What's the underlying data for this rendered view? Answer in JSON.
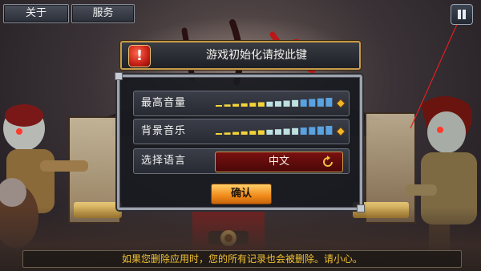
{
  "top_buttons": {
    "about_label": "关于",
    "service_label": "服务"
  },
  "pause": {
    "icon": "pause-icon"
  },
  "banner": {
    "icon": "alert-icon",
    "text": "游戏初始化请按此键"
  },
  "settings": {
    "volume_label": "最高音量",
    "bgm_label": "背景音乐",
    "language_label": "选择语言",
    "language_value": "中文",
    "language_icon": "cycle-icon",
    "confirm_label": "确认",
    "volume_level": 1.0,
    "bgm_level": 1.0
  },
  "warning": {
    "text": "如果您删除应用时，您的所有记录也会被删除。请小心。"
  },
  "colors": {
    "accent_gold": "#c79b4a",
    "warning_text": "#f2c232",
    "language_button": "#7a1010",
    "confirm_button": "#f08a1a"
  }
}
